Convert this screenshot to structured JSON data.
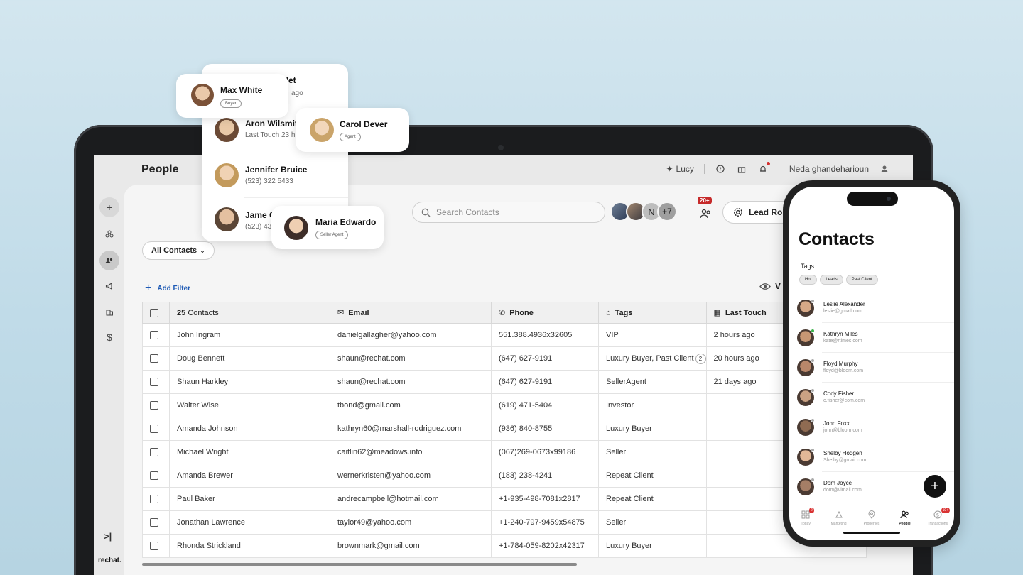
{
  "app": {
    "page_title": "People",
    "logo": "rechat."
  },
  "topbar": {
    "assistant_label": "Lucy",
    "user_name": "Neda ghandeharioun"
  },
  "toolbar": {
    "search_placeholder": "Search Contacts",
    "avatar_initial": "N",
    "avatar_more": "+7",
    "leads_badge": "20+",
    "lead_routing_label": "Lead Rou"
  },
  "filters": {
    "segment_label": "All Contacts",
    "add_filter_label": "Add Filter",
    "view_label": "V"
  },
  "table": {
    "count_number": "25",
    "count_label": "Contacts",
    "columns": [
      "Email",
      "Phone",
      "Tags",
      "Last Touch"
    ],
    "rows": [
      {
        "name": "John Ingram",
        "email": "danielgallagher@yahoo.com",
        "phone": "551.388.4936x32605",
        "tags": "VIP",
        "last_touch": "2 hours ago"
      },
      {
        "name": "Doug Bennett",
        "email": "shaun@rechat.com",
        "phone": "(647) 627-9191",
        "tags": "Luxury Buyer, Past Client",
        "tags_more": "2",
        "last_touch": "20 hours ago"
      },
      {
        "name": "Shaun Harkley",
        "email": "shaun@rechat.com",
        "phone": "(647) 627-9191",
        "tags": "SellerAgent",
        "last_touch": "21 days ago"
      },
      {
        "name": "Walter Wise",
        "email": "tbond@gmail.com",
        "phone": "(619) 471-5404",
        "tags": "Investor",
        "last_touch": ""
      },
      {
        "name": "Amanda Johnson",
        "email": "kathryn60@marshall-rodriguez.com",
        "phone": "(936) 840-8755",
        "tags": "Luxury Buyer",
        "last_touch": ""
      },
      {
        "name": "Michael Wright",
        "email": "caitlin62@meadows.info",
        "phone": "(067)269-0673x99186",
        "tags": "Seller",
        "last_touch": ""
      },
      {
        "name": "Amanda Brewer",
        "email": "wernerkristen@yahoo.com",
        "phone": "(183) 238-4241",
        "tags": "Repeat Client",
        "last_touch": ""
      },
      {
        "name": "Paul Baker",
        "email": "andrecampbell@hotmail.com",
        "phone": "+1-935-498-7081x2817",
        "tags": "Repeat Client",
        "last_touch": ""
      },
      {
        "name": "Jonathan Lawrence",
        "email": "taylor49@yahoo.com",
        "phone": "+1-240-797-9459x54875",
        "tags": "Seller",
        "last_touch": ""
      },
      {
        "name": "Rhonda Strickland",
        "email": "brownmark@gmail.com",
        "phone": "+1-784-059-8202x42317",
        "tags": "Luxury Buyer",
        "last_touch": ""
      }
    ]
  },
  "floating_cards": {
    "behind_name": "slet",
    "behind_sub": "ago",
    "max": {
      "name": "Max White",
      "tag": "Buyer"
    },
    "aron": {
      "name": "Aron Wilsmit",
      "sub": "Last Touch 23 h"
    },
    "carol": {
      "name": "Carol Dever",
      "tag": "Agent"
    },
    "jennifer": {
      "name": "Jennifer Bruice",
      "sub": "(523) 322 5433"
    },
    "jame": {
      "name": "Jame C",
      "sub": "(523) 43"
    },
    "maria": {
      "name": "Maria Edwardo",
      "tag": "Seller Agent"
    }
  },
  "phone": {
    "title": "Contacts",
    "tags_label": "Tags",
    "tags": [
      "Hot",
      "Leads",
      "Past Client"
    ],
    "contacts": [
      {
        "name": "Leslie Alexander",
        "email": "leslie@gmail.com"
      },
      {
        "name": "Kathryn Miles",
        "email": "kate@rtimes.com"
      },
      {
        "name": "Floyd Murphy",
        "email": "floyd@bloom.com"
      },
      {
        "name": "Cody Fisher",
        "email": "c.fisher@com.com"
      },
      {
        "name": "John Foxx",
        "email": "john@bloom.com"
      },
      {
        "name": "Shelby Hodgen",
        "email": "Shelby@gmail.com"
      },
      {
        "name": "Dom Joyce",
        "email": "dom@vimail.com"
      }
    ],
    "fab": "+",
    "nav": [
      {
        "label": "Today",
        "badge": "2"
      },
      {
        "label": "Marketing"
      },
      {
        "label": "Properties"
      },
      {
        "label": "People"
      },
      {
        "label": "Transactions",
        "badge": "10+"
      }
    ]
  }
}
